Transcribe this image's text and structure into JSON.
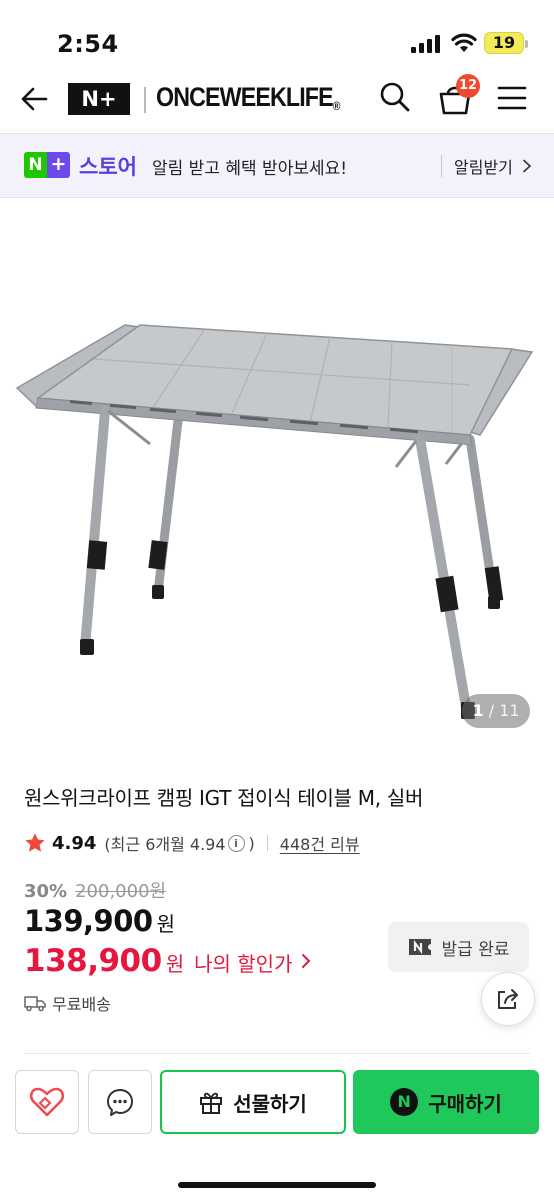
{
  "status_bar": {
    "time": "2:54",
    "battery": "19"
  },
  "header": {
    "logo": "N+",
    "brand": "ONCEWEEKLIFE",
    "brand_mark": "®",
    "cart_count": "12",
    "icons": [
      "back-arrow-icon",
      "search-icon",
      "cart-icon",
      "menu-icon"
    ]
  },
  "store_banner": {
    "logo_n": "N",
    "logo_plus": "+",
    "store_name": "스토어",
    "message": "알림 받고 혜택 받아보세요!",
    "alarm_label": "알림받기"
  },
  "gallery": {
    "current": "1",
    "total": "/ 11"
  },
  "product": {
    "title": "원스위크라이프 캠핑 IGT 접이식 테이블 M, 실버",
    "rating": "4.94",
    "recent_rating_prefix": "(최근 6개월 4.94",
    "recent_rating_suffix": ")",
    "review_link": "448건 리뷰",
    "discount_rate": "30%",
    "original_price": "200,000원",
    "price": "139,900",
    "price_unit": "원",
    "my_price": "138,900",
    "my_price_unit": "원",
    "my_price_label": "나의 할인가",
    "coupon_label": "발급 완료",
    "shipping": "무료배송"
  },
  "bottom_bar": {
    "gift_label": "선물하기",
    "buy_label": "구매하기",
    "buy_icon_letter": "N"
  },
  "colors": {
    "naver_green": "#1ec85a",
    "store_purple": "#6d4bea",
    "sale_red": "#e5173e",
    "cart_badge": "#f0492f"
  }
}
